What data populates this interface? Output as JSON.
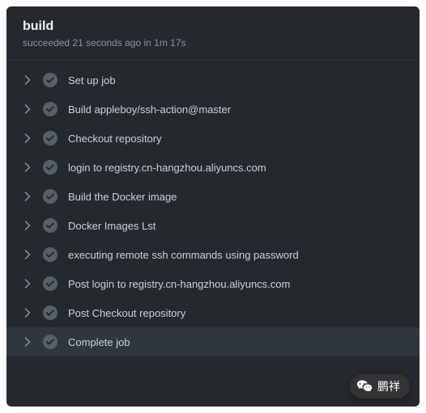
{
  "header": {
    "title": "build",
    "status": "succeeded",
    "time_ago": "21 seconds ago",
    "in_word": "in",
    "duration": "1m 17s"
  },
  "steps": [
    {
      "label": "Set up job",
      "status": "success"
    },
    {
      "label": "Build appleboy/ssh-action@master",
      "status": "success"
    },
    {
      "label": "Checkout repository",
      "status": "success"
    },
    {
      "label": "login to registry.cn-hangzhou.aliyuncs.com",
      "status": "success"
    },
    {
      "label": "Build the Docker image",
      "status": "success"
    },
    {
      "label": "Docker Images Lst",
      "status": "success"
    },
    {
      "label": "executing remote ssh commands using password",
      "status": "success"
    },
    {
      "label": "Post login to registry.cn-hangzhou.aliyuncs.com",
      "status": "success"
    },
    {
      "label": "Post Checkout repository",
      "status": "success"
    },
    {
      "label": "Complete job",
      "status": "success",
      "active": true
    }
  ],
  "badge": {
    "label": "鹏祥"
  }
}
